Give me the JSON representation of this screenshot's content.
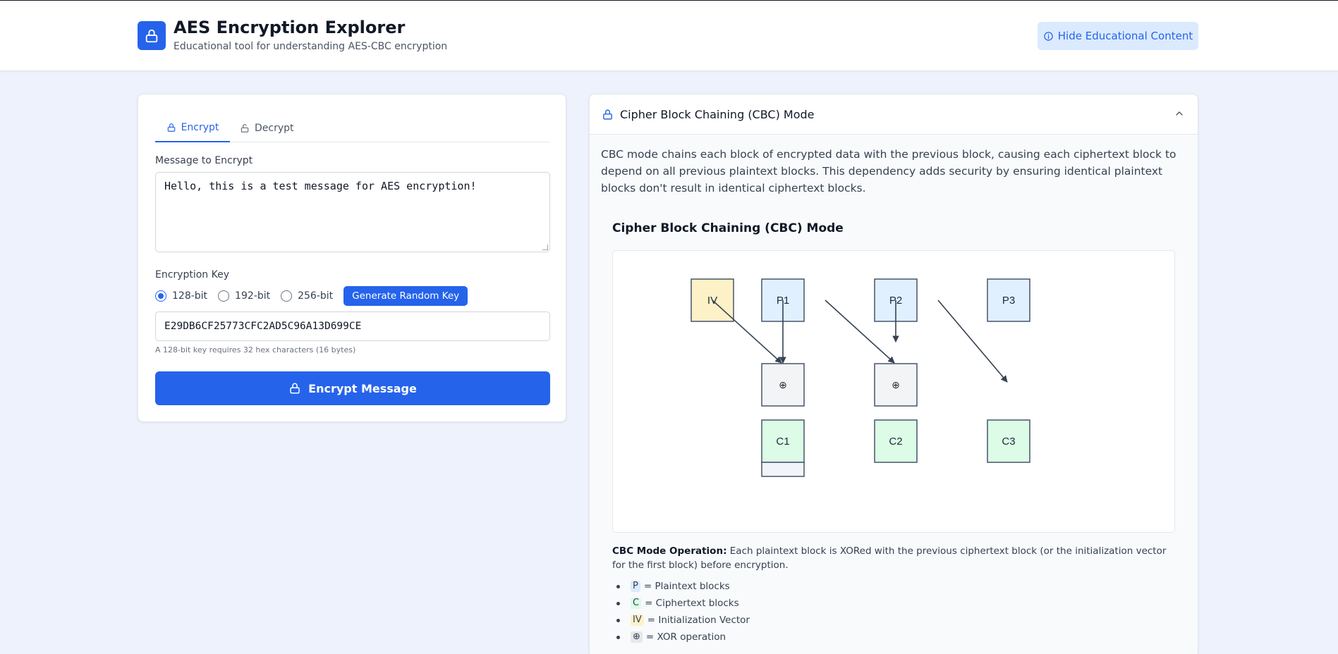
{
  "header": {
    "title": "AES Encryption Explorer",
    "subtitle": "Educational tool for understanding AES-CBC encryption",
    "edu_button": "Hide Educational Content"
  },
  "left_panel": {
    "tabs": [
      {
        "label": "Encrypt",
        "active": true
      },
      {
        "label": "Decrypt",
        "active": false
      }
    ],
    "message_label": "Message to Encrypt",
    "message_value": "Hello, this is a test message for AES encryption!",
    "key_label": "Encryption Key",
    "key_sizes": [
      {
        "label": "128-bit",
        "checked": true
      },
      {
        "label": "192-bit",
        "checked": false
      },
      {
        "label": "256-bit",
        "checked": false
      }
    ],
    "generate_button": "Generate Random Key",
    "key_value": "E29DB6CF25773CFC2AD5C96A13D699CE",
    "key_hint": "A 128-bit key requires 32 hex characters (16 bytes)",
    "encrypt_button": "Encrypt Message"
  },
  "right_panel": {
    "section_title": "Cipher Block Chaining (CBC) Mode",
    "description": "CBC mode chains each block of encrypted data with the previous block, causing each ciphertext block to depend on all previous plaintext blocks. This dependency adds security by ensuring identical plaintext blocks don't result in identical ciphertext blocks.",
    "diagram_title": "Cipher Block Chaining (CBC) Mode",
    "diagram": {
      "iv_label": "IV",
      "plaintext_labels": [
        "P1",
        "P2",
        "P3"
      ],
      "xor_symbol": "⊕",
      "ciphertext_labels": [
        "C1",
        "C2",
        "C3"
      ]
    },
    "operation_label": "CBC Mode Operation:",
    "operation_text": " Each plaintext block is XORed with the previous ciphertext block (or the initialization vector for the first block) before encryption.",
    "legend": [
      {
        "symbol": "P",
        "text": "= Plaintext blocks",
        "kind": "p"
      },
      {
        "symbol": "C",
        "text": "= Ciphertext blocks",
        "kind": "c"
      },
      {
        "symbol": "IV",
        "text": "= Initialization Vector",
        "kind": "iv"
      },
      {
        "symbol": "⊕",
        "text": "= XOR operation",
        "kind": "x"
      }
    ]
  },
  "colors": {
    "accent": "#2563eb",
    "plaintext_fill": "#e0f0fe",
    "ciphertext_fill": "#dcfce7",
    "iv_fill": "#fdf1c7",
    "xor_fill": "#f3f4f6",
    "block_stroke": "#475569"
  }
}
